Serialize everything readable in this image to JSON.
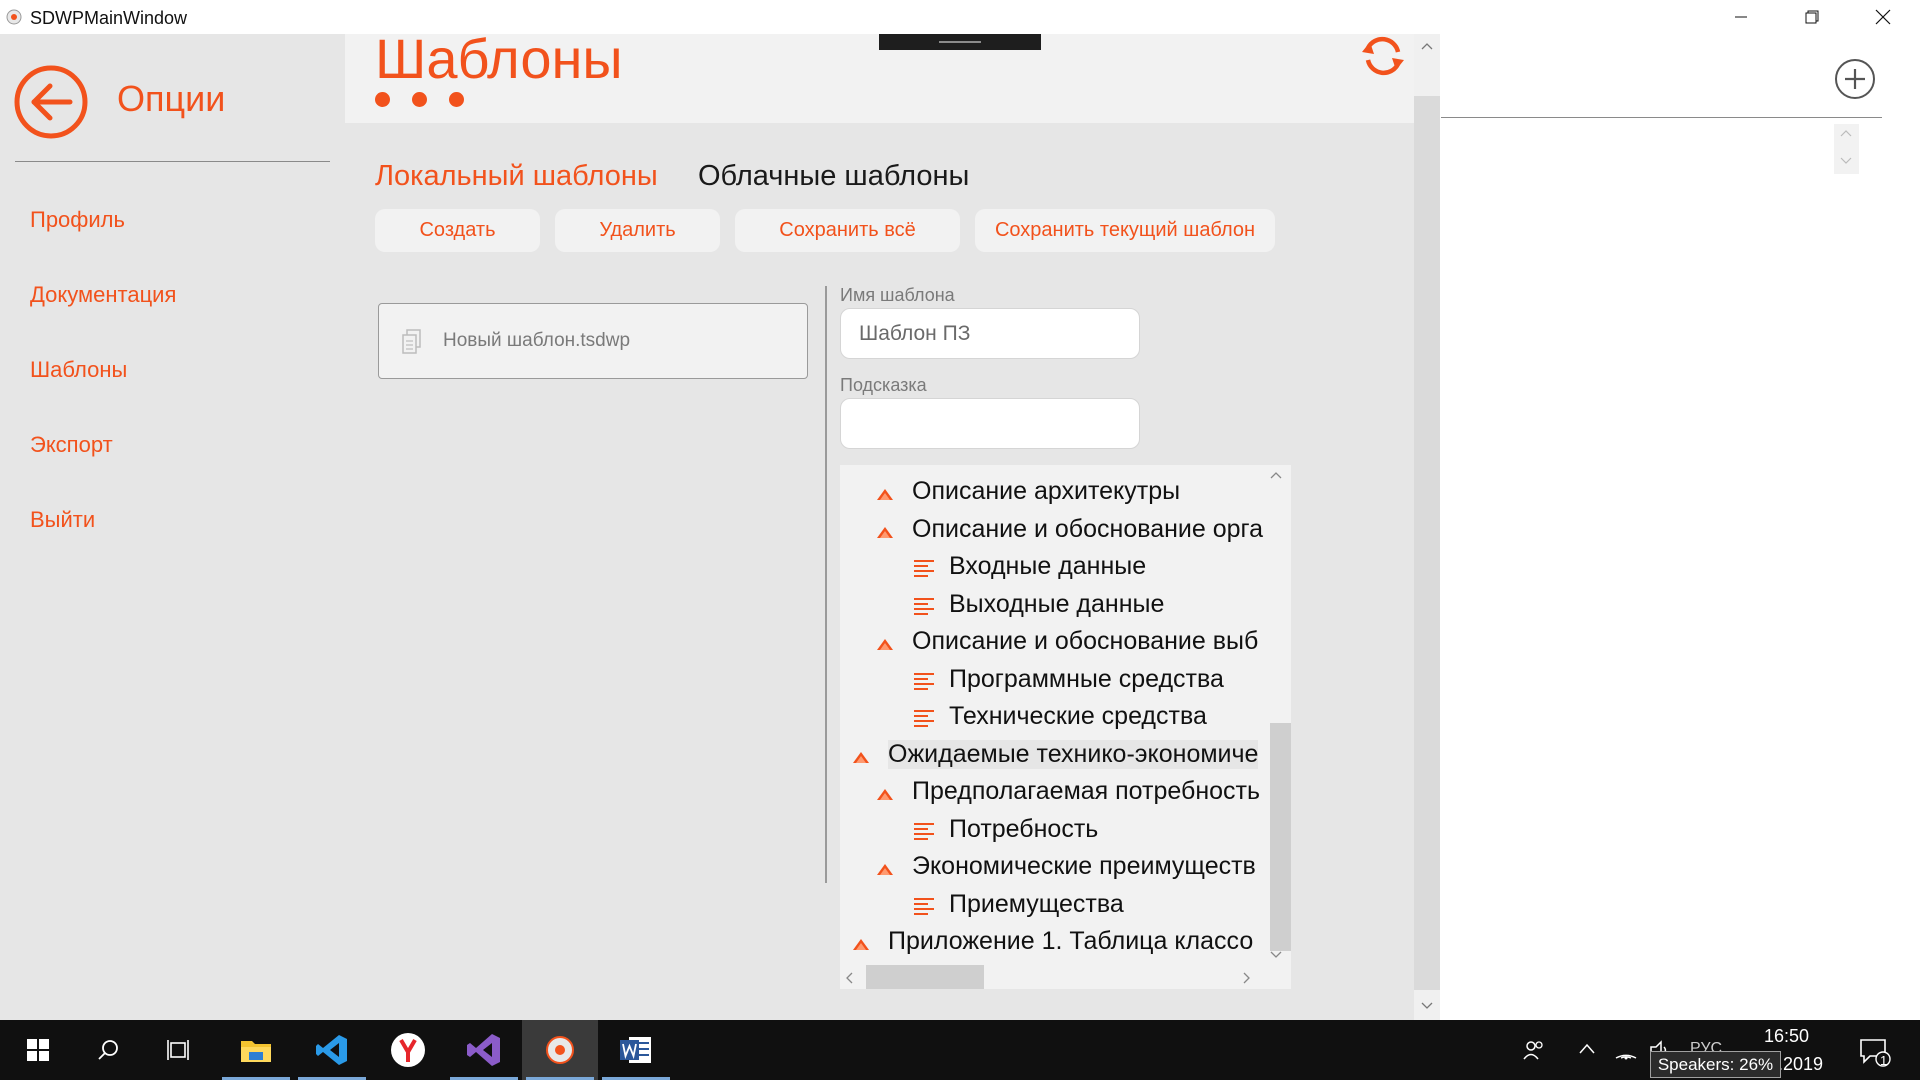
{
  "window": {
    "title": "SDWPMainWindow"
  },
  "sidebar": {
    "title": "Опции",
    "items": [
      {
        "label": "Профиль"
      },
      {
        "label": "Документация"
      },
      {
        "label": "Шаблоны"
      },
      {
        "label": "Экспорт"
      },
      {
        "label": "Выйти"
      }
    ]
  },
  "header": {
    "title": "Шаблоны"
  },
  "tabs": [
    {
      "label": "Локальный шаблоны",
      "active": true
    },
    {
      "label": "Облачные шаблоны",
      "active": false
    }
  ],
  "toolbar": {
    "create_label": "Создать",
    "delete_label": "Удалить",
    "save_all_label": "Сохранить всё",
    "save_current_label": "Сохранить текущий шаблон"
  },
  "files": [
    {
      "name": "Новый шаблон.tsdwp"
    }
  ],
  "form": {
    "name_label": "Имя шаблона",
    "name_value": "Шаблон ПЗ",
    "hint_label": "Подсказка",
    "hint_value": ""
  },
  "tree": {
    "items": [
      {
        "label": "Описание архитекутры",
        "level": 1,
        "type": "section"
      },
      {
        "label": "Описание и обоснование орга",
        "level": 1,
        "type": "section"
      },
      {
        "label": "Входные данные",
        "level": 2,
        "type": "text"
      },
      {
        "label": "Выходные данные",
        "level": 2,
        "type": "text"
      },
      {
        "label": "Описание и обоснование выб",
        "level": 1,
        "type": "section"
      },
      {
        "label": "Программные средства",
        "level": 2,
        "type": "text"
      },
      {
        "label": "Технические средства",
        "level": 2,
        "type": "text"
      },
      {
        "label": "Ожидаемые технико-экономиче",
        "level": 0,
        "type": "section",
        "selected": true
      },
      {
        "label": "Предполагаемая потребность",
        "level": 1,
        "type": "section"
      },
      {
        "label": "Потребность",
        "level": 2,
        "type": "text"
      },
      {
        "label": "Экономические преимуществ",
        "level": 1,
        "type": "section"
      },
      {
        "label": "Приемущества",
        "level": 2,
        "type": "text"
      },
      {
        "label": "Приложение 1. Таблица классо",
        "level": 0,
        "type": "section"
      }
    ]
  },
  "taskbar": {
    "apps": [
      "start",
      "search",
      "task-view",
      "file-explorer",
      "vscode",
      "yandex-browser",
      "visual-studio",
      "sdwp-app",
      "word"
    ],
    "lang": "РУС",
    "time": "16:50",
    "date": "5.2019",
    "notification_count": "1",
    "tooltip": "Speakers: 26%"
  },
  "colors": {
    "accent": "#f2521c",
    "sidebar_bg": "#e6e6e6",
    "taskbar_bg": "#101010"
  }
}
